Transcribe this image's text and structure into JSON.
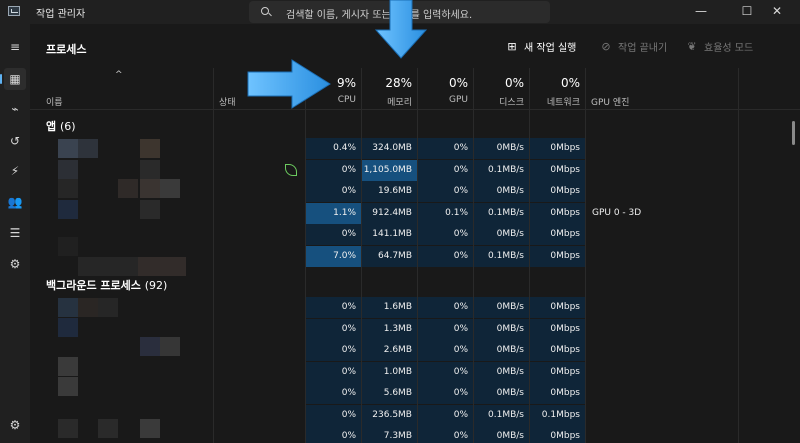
{
  "window": {
    "title": "작업 관리자",
    "search_placeholder": "검색할 이름, 게시자 또는 PID를 입력하세요.",
    "minimize": "—",
    "maximize": "☐",
    "close": "✕"
  },
  "sidebar": {
    "items": [
      {
        "icon": "hamburger-menu-icon",
        "glyph": "≡"
      },
      {
        "icon": "processes-icon",
        "glyph": "▦"
      },
      {
        "icon": "performance-icon",
        "glyph": "⌁"
      },
      {
        "icon": "app-history-icon",
        "glyph": "↺"
      },
      {
        "icon": "startup-apps-icon",
        "glyph": "⚡"
      },
      {
        "icon": "users-icon",
        "glyph": "👥"
      },
      {
        "icon": "details-icon",
        "glyph": "☰"
      },
      {
        "icon": "services-icon",
        "glyph": "⚙"
      }
    ],
    "settings_glyph": "⚙"
  },
  "toolbar": {
    "page_title": "프로세스",
    "new_task": "새 작업 실행",
    "end_task": "작업 끝내기",
    "efficiency_mode": "효율성 모드"
  },
  "columns": {
    "name": "이름",
    "status": "상태",
    "cpu": {
      "pct": "9%",
      "label": "CPU"
    },
    "memory": {
      "pct": "28%",
      "label": "메모리"
    },
    "gpu": {
      "pct": "0%",
      "label": "GPU"
    },
    "disk": {
      "pct": "0%",
      "label": "디스크"
    },
    "network": {
      "pct": "0%",
      "label": "네트워크"
    },
    "gpu_engine": "GPU 엔진"
  },
  "groups": {
    "apps": {
      "title": "앱",
      "count": "(6)"
    },
    "background": {
      "title": "백그라운드 프로세스",
      "count": "(92)"
    }
  },
  "app_rows": [
    {
      "cpu": "0.4%",
      "mem": "324.0MB",
      "gpu": "0%",
      "disk": "0MB/s",
      "net": "0Mbps",
      "engine": "",
      "eco": false
    },
    {
      "cpu": "0%",
      "mem": "1,105.0MB",
      "gpu": "0%",
      "disk": "0.1MB/s",
      "net": "0Mbps",
      "engine": "",
      "eco": true
    },
    {
      "cpu": "0%",
      "mem": "19.6MB",
      "gpu": "0%",
      "disk": "0MB/s",
      "net": "0Mbps",
      "engine": "",
      "eco": false
    },
    {
      "cpu": "1.1%",
      "mem": "912.4MB",
      "gpu": "0.1%",
      "disk": "0.1MB/s",
      "net": "0Mbps",
      "engine": "GPU 0 - 3D",
      "eco": false
    },
    {
      "cpu": "0%",
      "mem": "141.1MB",
      "gpu": "0%",
      "disk": "0MB/s",
      "net": "0Mbps",
      "engine": "",
      "eco": false
    },
    {
      "cpu": "7.0%",
      "mem": "64.7MB",
      "gpu": "0%",
      "disk": "0.1MB/s",
      "net": "0Mbps",
      "engine": "",
      "eco": false
    }
  ],
  "background_rows": [
    {
      "cpu": "0%",
      "mem": "1.6MB",
      "gpu": "0%",
      "disk": "0MB/s",
      "net": "0Mbps",
      "engine": ""
    },
    {
      "cpu": "0%",
      "mem": "1.3MB",
      "gpu": "0%",
      "disk": "0MB/s",
      "net": "0Mbps",
      "engine": ""
    },
    {
      "cpu": "0%",
      "mem": "2.6MB",
      "gpu": "0%",
      "disk": "0MB/s",
      "net": "0Mbps",
      "engine": ""
    },
    {
      "cpu": "0%",
      "mem": "1.0MB",
      "gpu": "0%",
      "disk": "0MB/s",
      "net": "0Mbps",
      "engine": ""
    },
    {
      "cpu": "0%",
      "mem": "5.6MB",
      "gpu": "0%",
      "disk": "0MB/s",
      "net": "0Mbps",
      "engine": ""
    },
    {
      "cpu": "0%",
      "mem": "236.5MB",
      "gpu": "0%",
      "disk": "0.1MB/s",
      "net": "0.1Mbps",
      "engine": ""
    },
    {
      "cpu": "0%",
      "mem": "7.3MB",
      "gpu": "0%",
      "disk": "0MB/s",
      "net": "0Mbps",
      "engine": ""
    }
  ],
  "colors": {
    "accent": "#5fb2f2",
    "cell_base": "#0f2538",
    "cell_medium": "#143a5a",
    "cell_high": "#16507e",
    "eco_leaf": "#6ccb5f",
    "annotation_arrow": "#3aa6f0"
  }
}
